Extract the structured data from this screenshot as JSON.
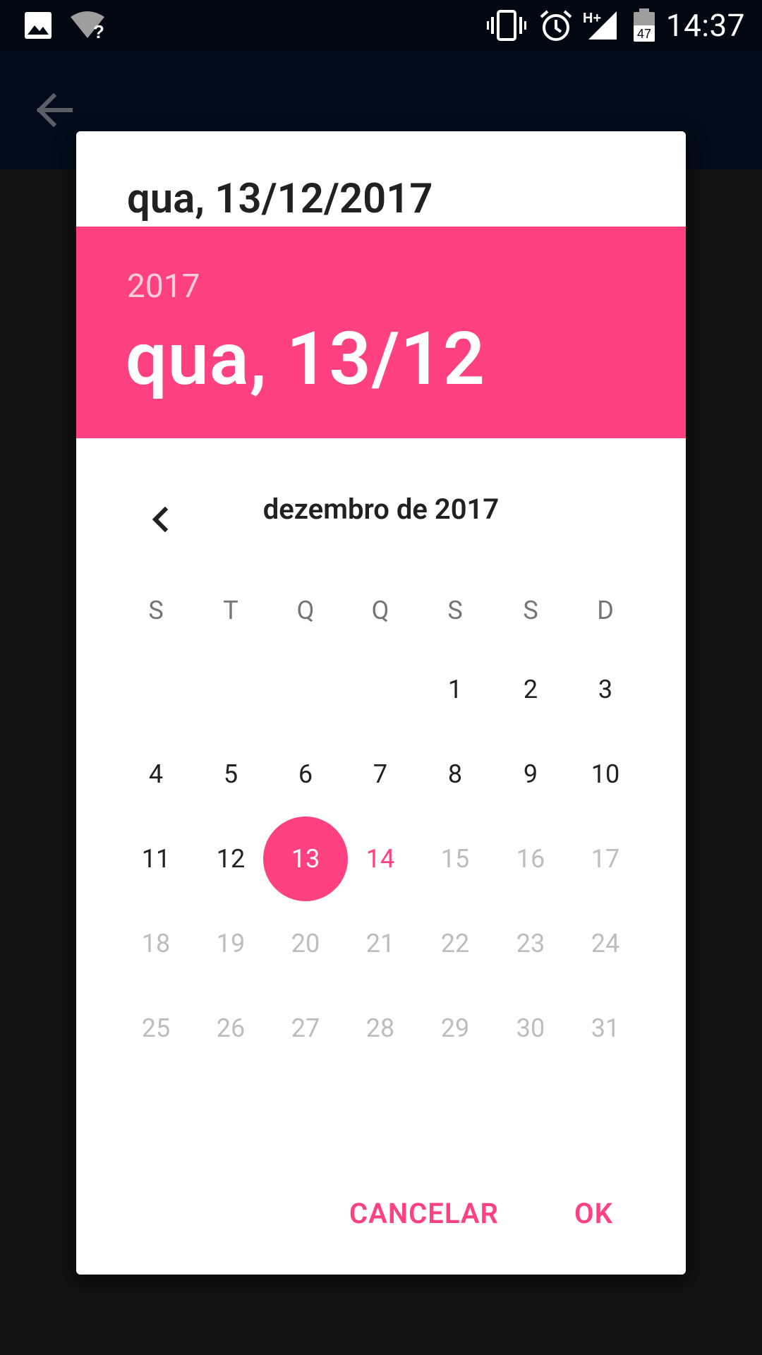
{
  "status_bar": {
    "time": "14:37",
    "battery": "47",
    "network": "H+",
    "icons": [
      "gallery-icon",
      "wifi-unknown-icon",
      "vibrate-icon",
      "alarm-icon",
      "signal-icon",
      "battery-icon"
    ]
  },
  "app_bar": {
    "back_icon": "arrow-back-icon"
  },
  "dialog": {
    "title": "qua, 13/12/2017",
    "header_year": "2017",
    "header_date": "qua, 13/12",
    "month_label": "dezembro de 2017",
    "prev_icon": "chevron-left-icon",
    "weekdays": [
      "S",
      "T",
      "Q",
      "Q",
      "S",
      "S",
      "D"
    ],
    "days": [
      "1",
      "2",
      "3",
      "4",
      "5",
      "6",
      "7",
      "8",
      "9",
      "10",
      "11",
      "12",
      "13",
      "14",
      "15",
      "16",
      "17",
      "18",
      "19",
      "20",
      "21",
      "22",
      "23",
      "24",
      "25",
      "26",
      "27",
      "28",
      "29",
      "30",
      "31"
    ],
    "first_weekday_index": 4,
    "selected_day": 13,
    "today_day": 14,
    "last_enabled_day": 14,
    "cancel_label": "CANCELAR",
    "ok_label": "OK"
  },
  "colors": {
    "accent": "#ff4081",
    "status_bar": "#010811",
    "app_bar": "#020c1a",
    "scrim": "#121212"
  }
}
